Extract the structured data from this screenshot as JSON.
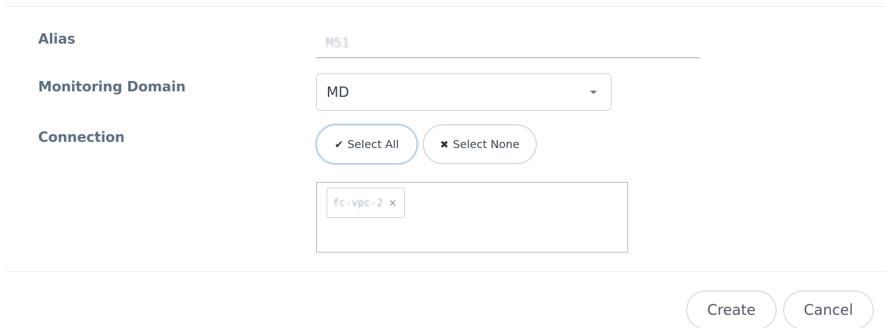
{
  "form": {
    "alias": {
      "label": "Alias",
      "value": "M51"
    },
    "monitoring_domain": {
      "label": "Monitoring Domain",
      "selected": "MD"
    },
    "connection": {
      "label": "Connection",
      "select_all_label": "Select All",
      "select_none_label": "Select None",
      "tags": [
        {
          "text": "fc-vpc-2",
          "remove_glyph": "×"
        }
      ]
    }
  },
  "footer": {
    "create_label": "Create",
    "cancel_label": "Cancel"
  },
  "icons": {
    "select_all": "checkmark-icon",
    "select_none": "x-icon",
    "dropdown": "caret-down-icon"
  }
}
